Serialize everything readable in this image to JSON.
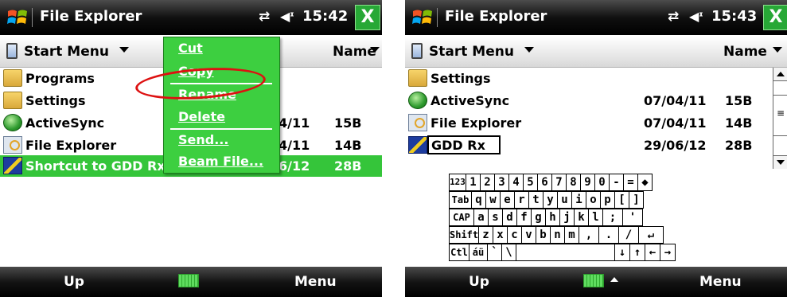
{
  "left": {
    "title_bar": {
      "title": "File Explorer",
      "clock": "15:42",
      "close_label": "X"
    },
    "path_bar": {
      "location": "Start Menu",
      "sort_label": "Name"
    },
    "files": [
      {
        "name": "Programs",
        "icon": "folder-icon",
        "date": "",
        "size": ""
      },
      {
        "name": "Settings",
        "icon": "folder-icon",
        "date": "",
        "size": ""
      },
      {
        "name": "ActiveSync",
        "icon": "sync-icon",
        "date": "4/11",
        "size": "15B"
      },
      {
        "name": "File Explorer",
        "icon": "explorer-icon",
        "date": "4/11",
        "size": "14B"
      },
      {
        "name": "Shortcut to GDD Rx",
        "icon": "gdd-icon",
        "date": "6/12",
        "size": "28B"
      }
    ],
    "context_menu": [
      "Cut",
      "Copy",
      "Rename",
      "Delete",
      "Send...",
      "Beam File..."
    ],
    "softkeys": {
      "left": "Up",
      "right": "Menu"
    }
  },
  "right": {
    "title_bar": {
      "title": "File Explorer",
      "clock": "15:43",
      "close_label": "X"
    },
    "path_bar": {
      "location": "Start Menu",
      "sort_label": "Name"
    },
    "files": [
      {
        "name": "Settings",
        "icon": "folder-icon",
        "date": "",
        "size": ""
      },
      {
        "name": "ActiveSync",
        "icon": "sync-icon",
        "date": "07/04/11",
        "size": "15B"
      },
      {
        "name": "File Explorer",
        "icon": "explorer-icon",
        "date": "07/04/11",
        "size": "14B"
      },
      {
        "name": "GDD Rx",
        "icon": "gdd-icon",
        "date": "29/06/12",
        "size": "28B"
      }
    ],
    "keyboard_rows": [
      [
        "123",
        "1",
        "2",
        "3",
        "4",
        "5",
        "6",
        "7",
        "8",
        "9",
        "0",
        "-",
        "=",
        "◆"
      ],
      [
        "Tab",
        "q",
        "w",
        "e",
        "r",
        "t",
        "y",
        "u",
        "i",
        "o",
        "p",
        "[",
        "]"
      ],
      [
        "CAP",
        "a",
        "s",
        "d",
        "f",
        "g",
        "h",
        "j",
        "k",
        "l",
        ";",
        "'"
      ],
      [
        "Shift",
        "z",
        "x",
        "c",
        "v",
        "b",
        "n",
        "m",
        ",",
        ".",
        "/",
        "↵"
      ],
      [
        "Ctl",
        "áü",
        "`",
        "\\",
        "",
        "↓",
        "↑",
        "←",
        "→"
      ]
    ],
    "softkeys": {
      "left": "Up",
      "right": "Menu"
    }
  }
}
